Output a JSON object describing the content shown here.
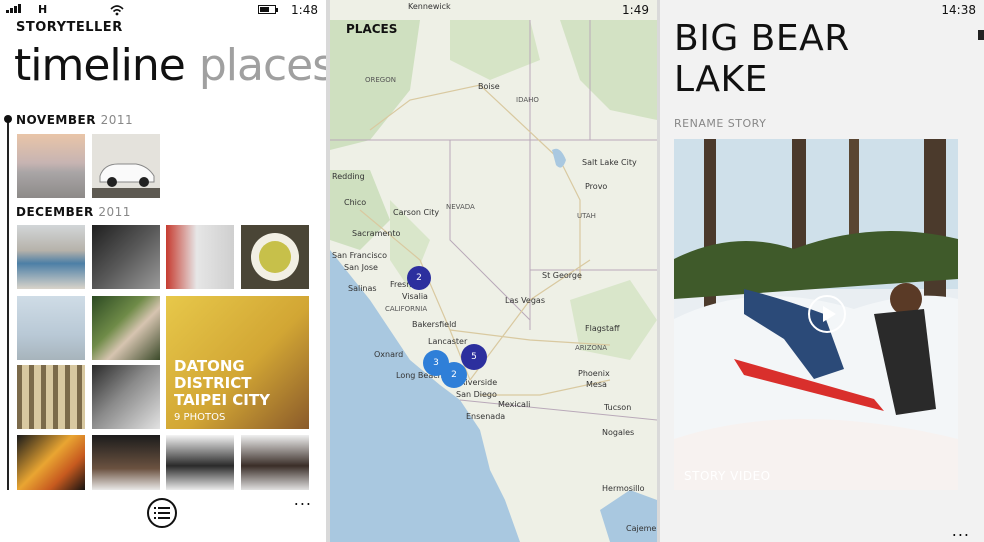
{
  "screen1": {
    "status": {
      "network": "H",
      "time": "1:48"
    },
    "app_title": "STORYTELLER",
    "pivot": {
      "active": "timeline",
      "inactive": "places"
    },
    "months": [
      {
        "name": "NOVEMBER",
        "year": "2011"
      },
      {
        "name": "DECEMBER",
        "year": "2011"
      }
    ],
    "featured": {
      "title": "DATONG DISTRICT TAIPEI CITY",
      "count": "9 PHOTOS"
    },
    "more": "..."
  },
  "screen2": {
    "status": {
      "time": "1:49"
    },
    "header": "PLACES",
    "regions": [
      "OREGON",
      "IDAHO",
      "NEVADA",
      "UTAH",
      "CALIFORNIA",
      "ARIZONA"
    ],
    "cities": [
      "Kennewick",
      "Boise",
      "Salt Lake City",
      "Provo",
      "Redding",
      "Chico",
      "Carson City",
      "Sacramento",
      "San Francisco",
      "San Jose",
      "Salinas",
      "Fresno",
      "Visalia",
      "St George",
      "Las Vegas",
      "Bakersfield",
      "Flagstaff",
      "Oxnard",
      "Lancaster",
      "Long Beach",
      "Riverside",
      "San Diego",
      "Phoenix",
      "Mesa",
      "Mexicali",
      "Ensenada",
      "Tucson",
      "Nogales",
      "Hermosillo",
      "Cajeme"
    ],
    "clusters": [
      "2",
      "5",
      "3",
      "2"
    ]
  },
  "screen3": {
    "status": {
      "time": "14:38"
    },
    "title_line1": "BIG BEAR",
    "title_line2": "LAKE",
    "rename": "RENAME STORY",
    "video_label": "STORY VIDEO",
    "more": "..."
  },
  "colors": {
    "cluster": "#2c2f9e",
    "cluster_light": "#2f7fd8",
    "featured": "#e2bd3e"
  }
}
